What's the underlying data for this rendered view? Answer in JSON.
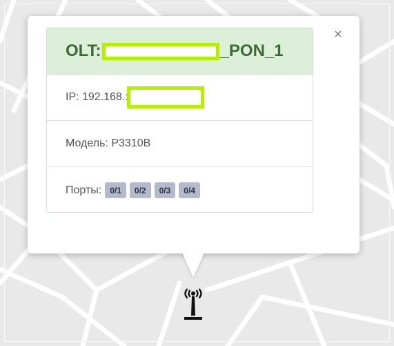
{
  "popup": {
    "close_label": "×",
    "title_prefix": "OLT:",
    "title_suffix": "_PON_1",
    "ip_label": "IP: 192.168.:",
    "model_label": "Модель: P3310B",
    "ports_label": "Порты:",
    "ports": [
      "0/1",
      "0/2",
      "0/3",
      "0/4"
    ]
  },
  "colors": {
    "header_bg": "#dcefd9",
    "header_text": "#3e6a34",
    "redaction": "#b6f000",
    "port_badge": "#b4b9cc"
  },
  "icons": {
    "marker": "radio-tower-icon",
    "close": "close-icon"
  }
}
